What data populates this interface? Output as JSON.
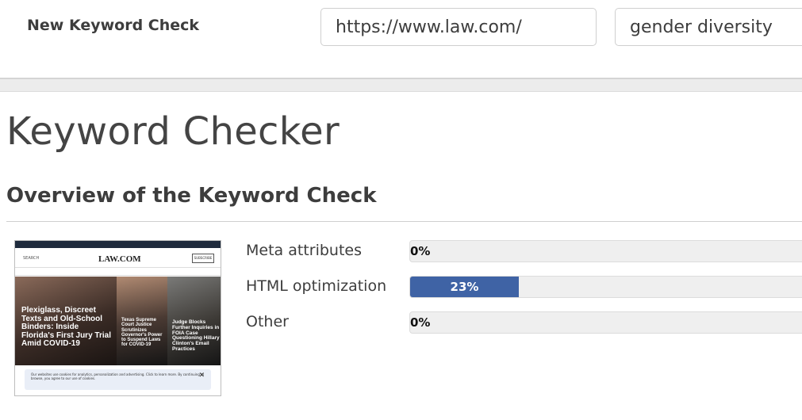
{
  "toolbar": {
    "new_keyword_label": "New Keyword Check",
    "url_value": "https://www.law.com/",
    "keyword_value": "gender diversity"
  },
  "page": {
    "title": "Keyword Checker",
    "section_title": "Overview of the Keyword Check"
  },
  "thumbnail": {
    "logo": "LAW.COM",
    "search": "SEARCH",
    "subscribe": "SUBSCRIBE",
    "headline_main": "Plexiglass, Discreet Texts and Old-School Binders: Inside Florida's First Jury Trial Amid COVID-19",
    "headline_2": "Texas Supreme Court Justice Scrutinizes Governor's Power to Suspend Laws for COVID-19",
    "headline_3": "Judge Blocks Further Inquiries in FOIA Case Questioning Hillary Clinton's Email Practices",
    "cookie_text": "Our websites use cookies for analytics, personalization and advertising. Click to learn more. By continuing to browse, you agree to our use of cookies."
  },
  "metrics": [
    {
      "label": "Meta attributes",
      "percent_text": "0%",
      "value": 0
    },
    {
      "label": "HTML optimization",
      "percent_text": "23%",
      "value": 23
    },
    {
      "label": "Other",
      "percent_text": "0%",
      "value": 0
    }
  ],
  "colors": {
    "bar_fill": "#3f63a5",
    "bar_track": "#efefef"
  }
}
